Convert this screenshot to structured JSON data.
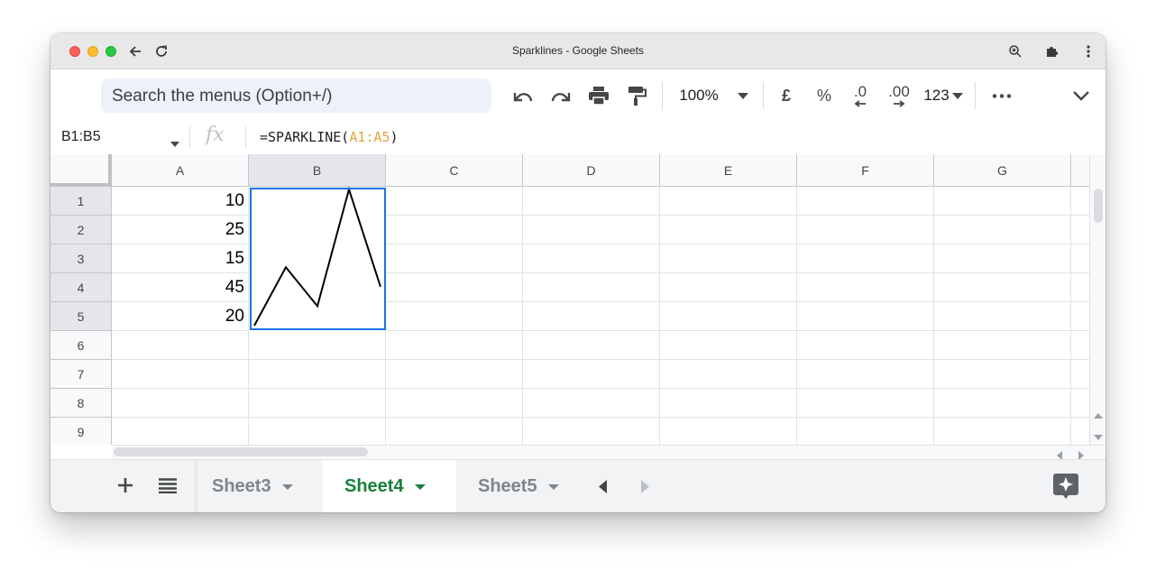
{
  "window": {
    "title": "Sparklines - Google Sheets"
  },
  "toolbar": {
    "search_placeholder": "Search the menus (Option+/)",
    "zoom": "100%",
    "currency": "£",
    "percent": "%",
    "decrease_decimal": ".0",
    "increase_decimal": ".00",
    "number_format": "123"
  },
  "formula_bar": {
    "name_box": "B1:B5",
    "formula_prefix": "=SPARKLINE(",
    "formula_ref": "A1:A5",
    "formula_suffix": ")"
  },
  "grid": {
    "columns": [
      "A",
      "B",
      "C",
      "D",
      "E",
      "F",
      "G"
    ],
    "rows": [
      "1",
      "2",
      "3",
      "4",
      "5",
      "6",
      "7",
      "8",
      "9"
    ],
    "column_a_values": [
      "10",
      "25",
      "15",
      "45",
      "20"
    ]
  },
  "sparkline": {
    "values": [
      10,
      25,
      15,
      45,
      20
    ],
    "color": "#000000"
  },
  "sheets": {
    "tabs": [
      {
        "label": "Sheet3",
        "active": false
      },
      {
        "label": "Sheet4",
        "active": true
      },
      {
        "label": "Sheet5",
        "active": false
      }
    ]
  },
  "colors": {
    "selection": "#1a73e8",
    "active_tab": "#188038",
    "formula_ref": "#e8a33b"
  },
  "icons": [
    "back-icon",
    "reload-icon",
    "zoom-icon",
    "extensions-icon",
    "more-vert-icon",
    "undo-icon",
    "redo-icon",
    "print-icon",
    "paint-format-icon",
    "chevron-down-icon",
    "more-horiz-icon",
    "add-sheet-icon",
    "all-sheets-icon",
    "explore-icon"
  ]
}
